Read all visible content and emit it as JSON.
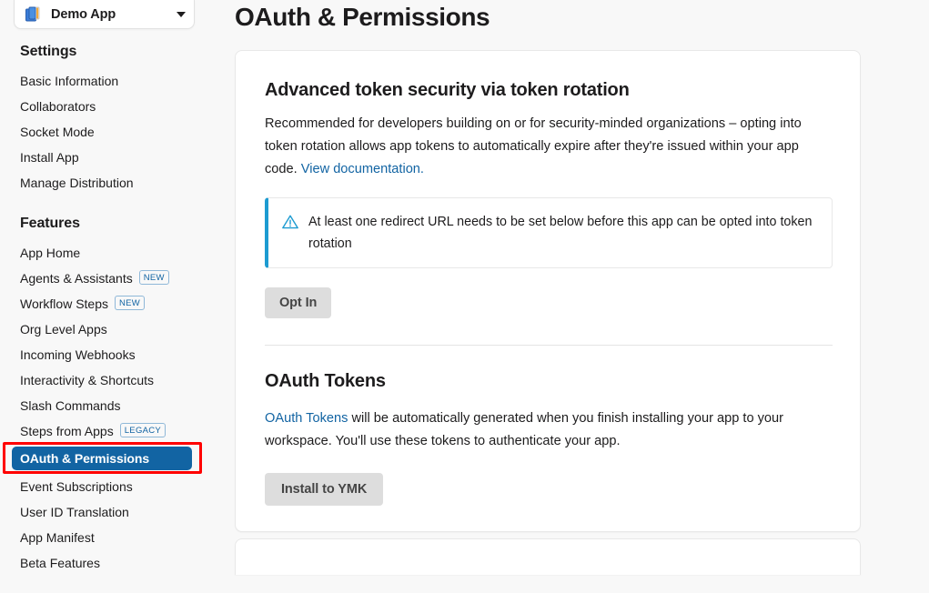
{
  "app_switcher": {
    "name": "Demo App",
    "icon": "app-stack-icon",
    "chevron": "chevron-down-icon"
  },
  "sidebar": {
    "groups": [
      {
        "heading": "Settings",
        "items": [
          {
            "label": "Basic Information",
            "badge": null,
            "active": false
          },
          {
            "label": "Collaborators",
            "badge": null,
            "active": false
          },
          {
            "label": "Socket Mode",
            "badge": null,
            "active": false
          },
          {
            "label": "Install App",
            "badge": null,
            "active": false
          },
          {
            "label": "Manage Distribution",
            "badge": null,
            "active": false
          }
        ]
      },
      {
        "heading": "Features",
        "items": [
          {
            "label": "App Home",
            "badge": null,
            "active": false
          },
          {
            "label": "Agents & Assistants",
            "badge": "NEW",
            "active": false
          },
          {
            "label": "Workflow Steps",
            "badge": "NEW",
            "active": false
          },
          {
            "label": "Org Level Apps",
            "badge": null,
            "active": false
          },
          {
            "label": "Incoming Webhooks",
            "badge": null,
            "active": false
          },
          {
            "label": "Interactivity & Shortcuts",
            "badge": null,
            "active": false
          },
          {
            "label": "Slash Commands",
            "badge": null,
            "active": false
          },
          {
            "label": "Steps from Apps",
            "badge": "LEGACY",
            "active": false
          },
          {
            "label": "OAuth & Permissions",
            "badge": null,
            "active": true
          },
          {
            "label": "Event Subscriptions",
            "badge": null,
            "active": false
          },
          {
            "label": "User ID Translation",
            "badge": null,
            "active": false
          },
          {
            "label": "App Manifest",
            "badge": null,
            "active": false
          },
          {
            "label": "Beta Features",
            "badge": null,
            "active": false
          }
        ]
      }
    ]
  },
  "main": {
    "page_title": "OAuth & Permissions",
    "token_rotation": {
      "title": "Advanced token security via token rotation",
      "description_part1": "Recommended for developers building on or for security-minded organizations – opting into token rotation allows app tokens to automatically expire after they're issued within your app code. ",
      "doc_link": "View documentation.",
      "callout": {
        "icon": "warning-triangle-icon",
        "text": "At least one redirect URL needs to be set below before this app can be opted into token rotation"
      },
      "opt_in_button": "Opt In"
    },
    "oauth_tokens": {
      "title": "OAuth Tokens",
      "link_text": "OAuth Tokens",
      "description_rest": " will be automatically generated when you finish installing your app to your workspace. You'll use these tokens to authenticate your app.",
      "install_button": "Install to YMK"
    }
  },
  "colors": {
    "accent_blue": "#1264a3",
    "callout_blue": "#1d9bd1",
    "annotation_red": "#ff0000",
    "page_bg": "#f8f8f8",
    "card_bg": "#ffffff",
    "button_grey": "#dddddd"
  }
}
